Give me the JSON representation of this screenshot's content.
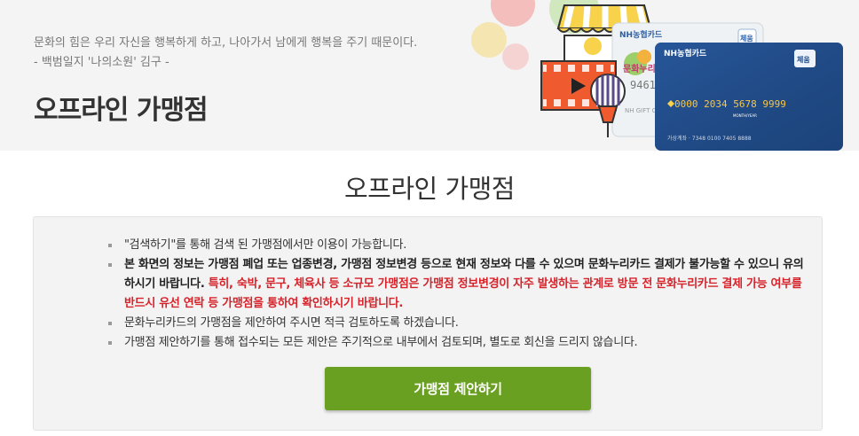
{
  "hero": {
    "quote_line1": "문화의 힘은 우리 자신을 행복하게 하고, 나아가서 남에게 행복을 주기 때문이다.",
    "quote_line2": "- 백범일지 '나의소원' 김구 -",
    "title": "오프라인 가맹점"
  },
  "cards": {
    "front_brand": "NH농협카드",
    "front_number": "0000 2034 5678 9999",
    "front_expiry_label": "MONTH/YEAR",
    "front_badge": "체움",
    "front_account": "가상계좌 · 7348 0100 7405 8888",
    "back_brand": "NH농협카드",
    "back_badge": "체움",
    "back_logo": "문화누리",
    "back_number": "9461",
    "back_text": "NH GIFT CA"
  },
  "section": {
    "title": "오프라인 가맹점"
  },
  "notice": {
    "item1": "\"검색하기\"를 통해 검색 된 가맹점에서만 이용이 가능합니다.",
    "item2_black": "본 화면의 정보는 가맹점 폐업 또는 업종변경, 가맹점 정보변경 등으로 현재 정보와 다를 수 있으며 문화누리카드 결제가 불가능할 수 있으니 유의하시기 바랍니다. ",
    "item2_red": "특히, 숙박, 문구, 체육사 등 소규모 가맹점은 가맹점 정보변경이 자주 발생하는 관계로 방문 전 문화누리카드 결제 가능 여부를 반드시 유선 연락 등 가맹점을 통하여 확인하시기 바랍니다.",
    "item3": "문화누리카드의 가맹점을 제안하여 주시면 적극 검토하도록 하겠습니다.",
    "item4": "가맹점 제안하기를 통해 접수되는 모든 제안은 주기적으로 내부에서 검토되며, 별도로 회신을 드리지 않습니다."
  },
  "button": {
    "label": "가맹점 제안하기"
  },
  "colors": {
    "accent_green": "#6aa022",
    "warning_red": "#d6232b",
    "hero_bg": "#f4f4f4",
    "card_navy": "#1f4a86"
  },
  "icons": [
    "shop-awning-icon",
    "film-clapper-icon",
    "striped-balloon-icon",
    "chip-icon"
  ]
}
